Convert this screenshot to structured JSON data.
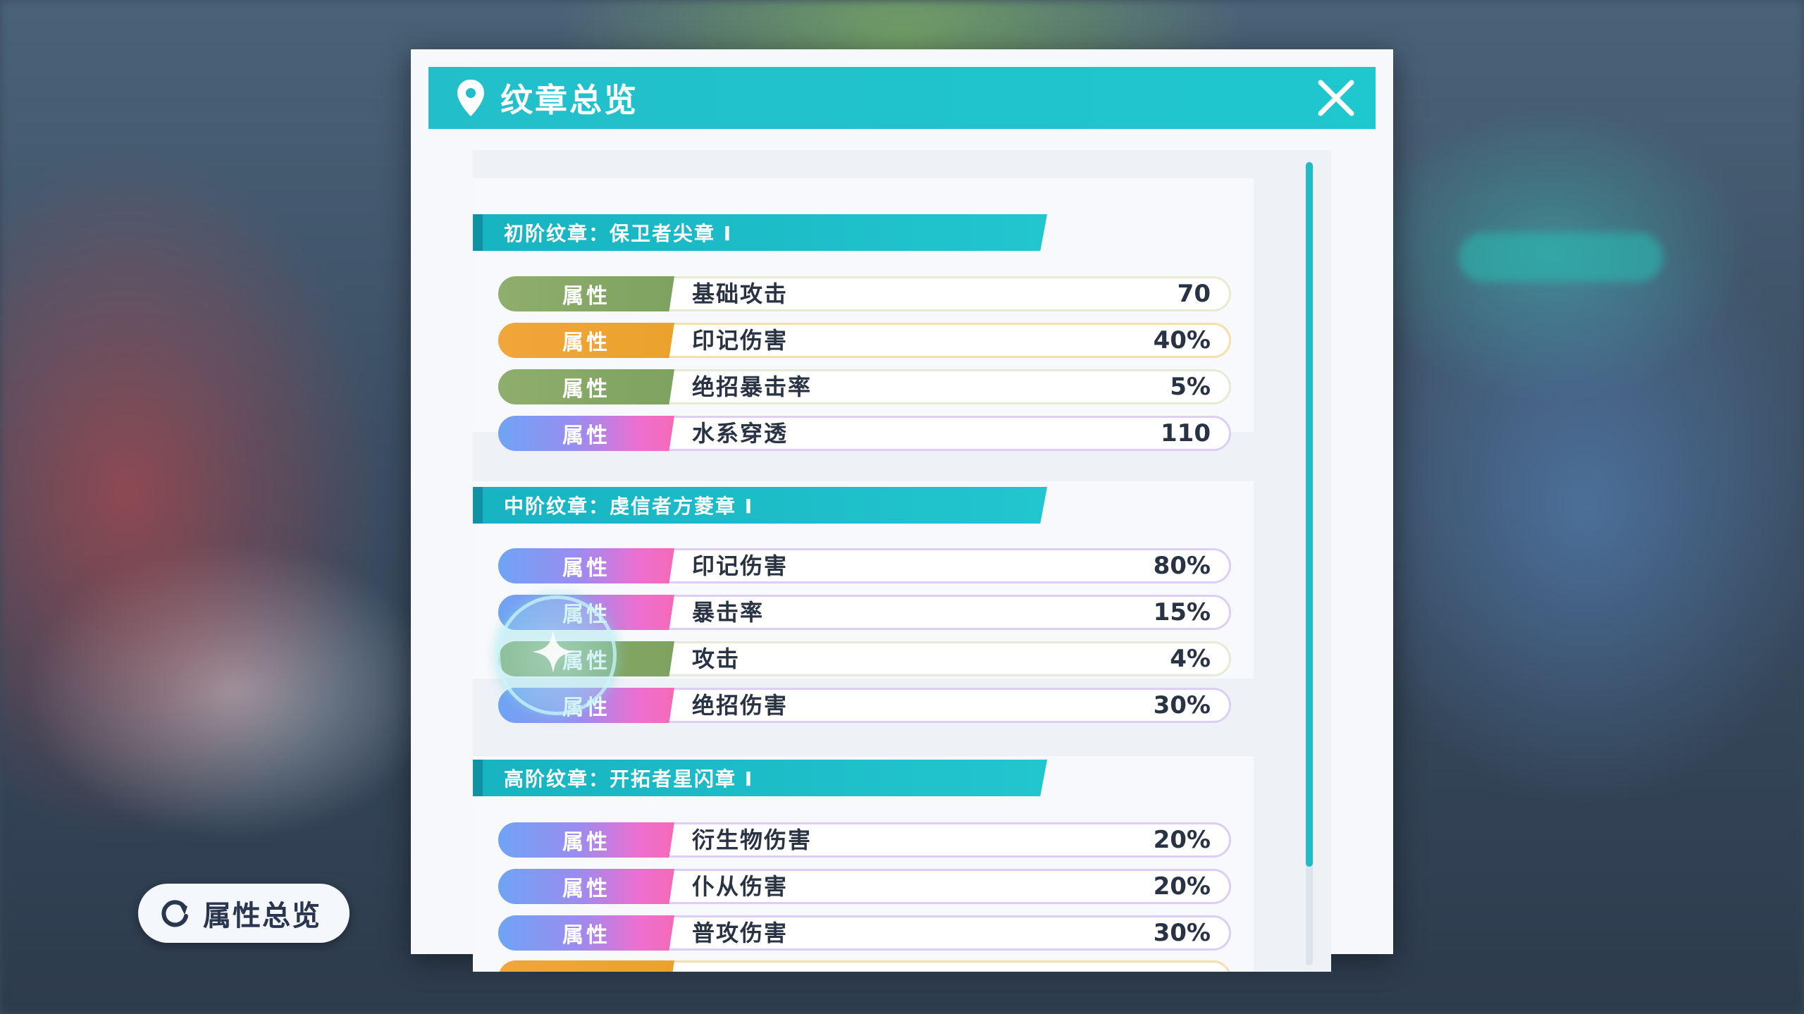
{
  "panel": {
    "title": "纹章总览"
  },
  "side_button": {
    "label": "属性总览"
  },
  "sections": [
    {
      "header": "初阶纹章：保卫者尖章 I",
      "rows": [
        {
          "tag": "属性",
          "name": "基础攻击",
          "value": "70",
          "color": "green"
        },
        {
          "tag": "属性",
          "name": "印记伤害",
          "value": "40%",
          "color": "orange"
        },
        {
          "tag": "属性",
          "name": "绝招暴击率",
          "value": "5%",
          "color": "green"
        },
        {
          "tag": "属性",
          "name": "水系穿透",
          "value": "110",
          "color": "rainbow"
        }
      ]
    },
    {
      "header": "中阶纹章：虔信者方菱章 I",
      "rows": [
        {
          "tag": "属性",
          "name": "印记伤害",
          "value": "80%",
          "color": "rainbow"
        },
        {
          "tag": "属性",
          "name": "暴击率",
          "value": "15%",
          "color": "rainbow"
        },
        {
          "tag": "属性",
          "name": "攻击",
          "value": "4%",
          "color": "green"
        },
        {
          "tag": "属性",
          "name": "绝招伤害",
          "value": "30%",
          "color": "rainbow"
        }
      ]
    },
    {
      "header": "高阶纹章：开拓者星闪章 I",
      "rows": [
        {
          "tag": "属性",
          "name": "衍生物伤害",
          "value": "20%",
          "color": "rainbow"
        },
        {
          "tag": "属性",
          "name": "仆从伤害",
          "value": "20%",
          "color": "rainbow"
        },
        {
          "tag": "属性",
          "name": "普攻伤害",
          "value": "30%",
          "color": "rainbow"
        }
      ]
    }
  ],
  "colors": {
    "accent": "#1fc0cb",
    "green_tag": "#86a866",
    "orange_tag": "#f0a433",
    "rainbow_start": "#6ea4f4",
    "rainbow_end": "#f56ab7"
  }
}
